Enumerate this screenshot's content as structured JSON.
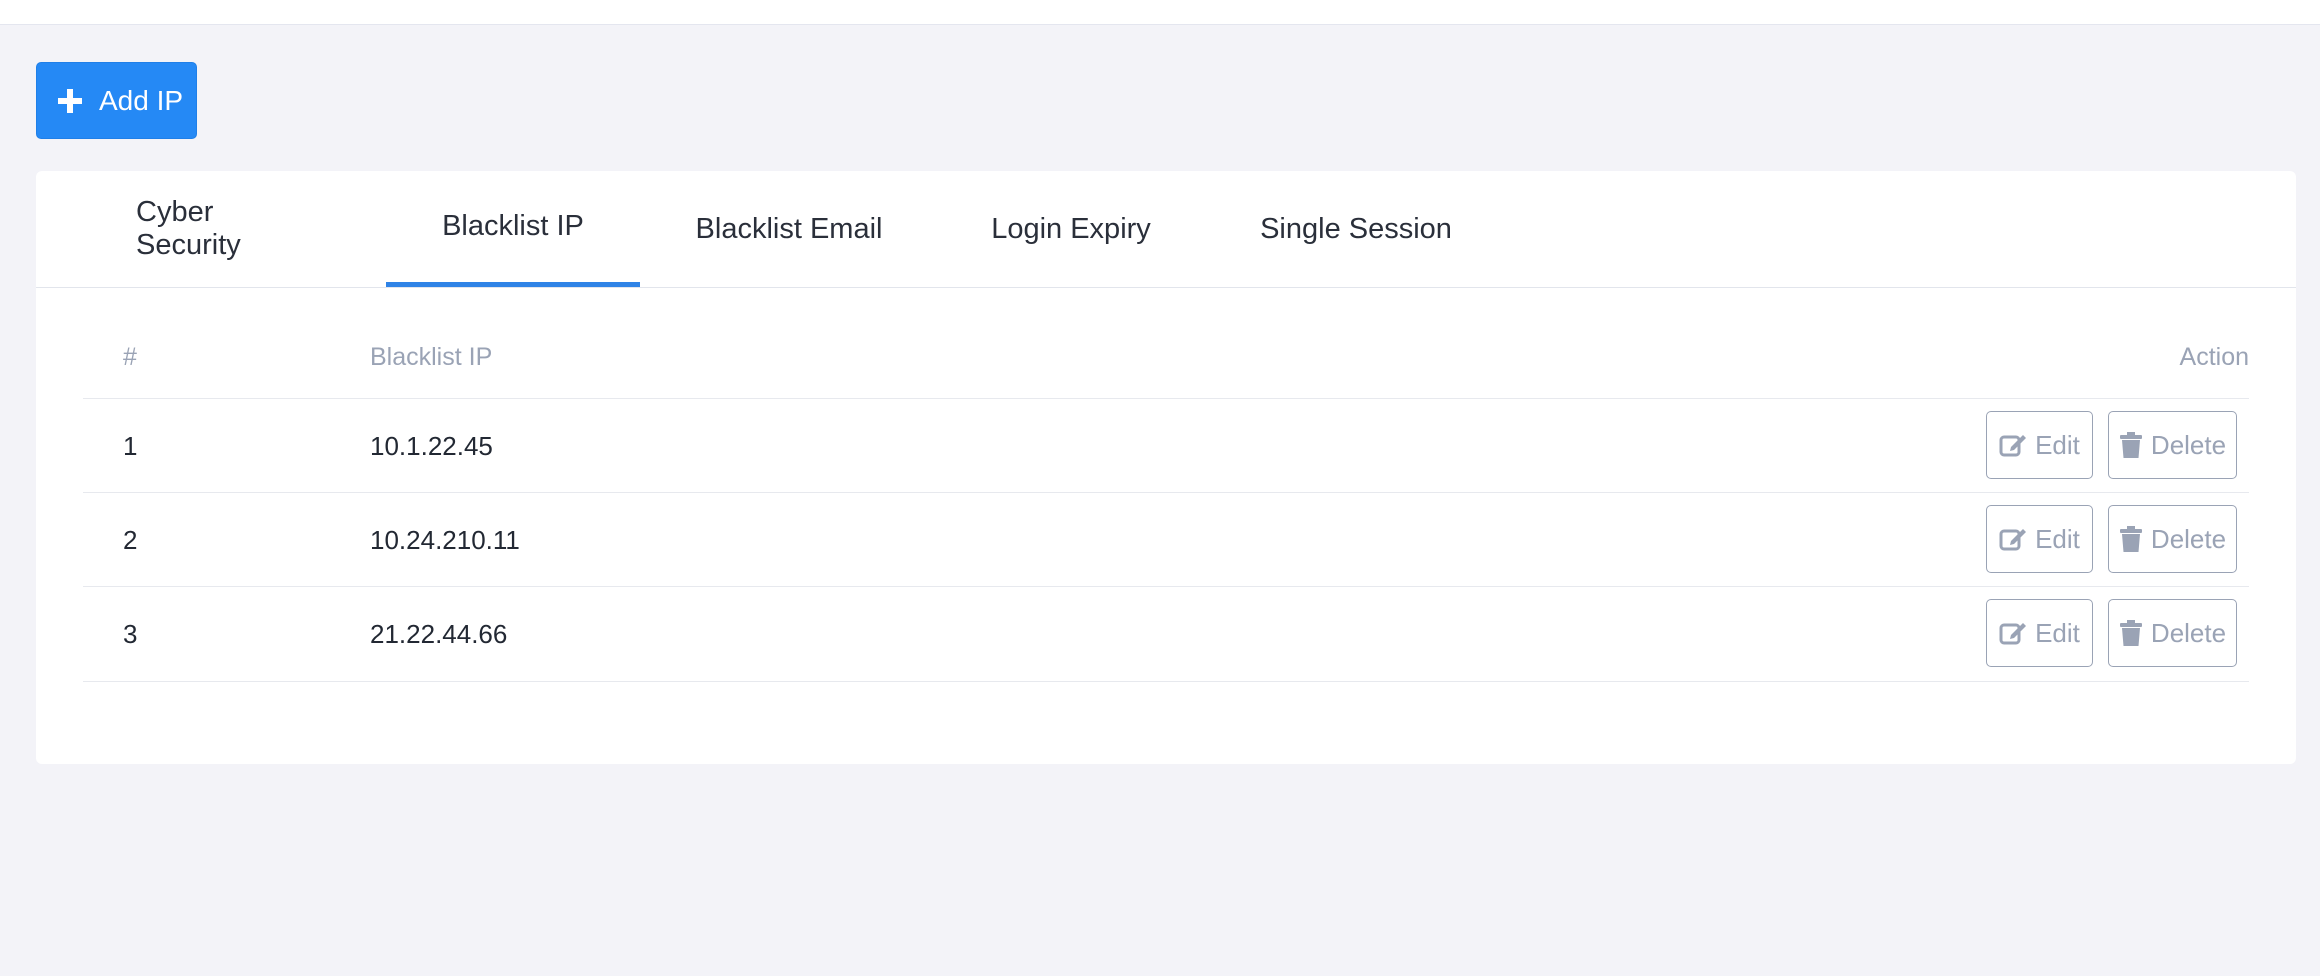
{
  "toolbar": {
    "add_label": "Add IP",
    "accent": "#2589f5"
  },
  "tabs": [
    {
      "label": "Cyber Security",
      "active": false
    },
    {
      "label": "Blacklist IP",
      "active": true
    },
    {
      "label": "Blacklist Email",
      "active": false
    },
    {
      "label": "Login Expiry",
      "active": false
    },
    {
      "label": "Single Session",
      "active": false
    }
  ],
  "table": {
    "headers": {
      "index": "#",
      "ip": "Blacklist IP",
      "action": "Action"
    },
    "rows": [
      {
        "index": "1",
        "ip": "10.1.22.45"
      },
      {
        "index": "2",
        "ip": "10.24.210.11"
      },
      {
        "index": "3",
        "ip": "21.22.44.66"
      }
    ],
    "edit_label": "Edit",
    "delete_label": "Delete"
  },
  "icons": {
    "add": "plus-icon",
    "edit": "edit-icon",
    "delete": "trash-icon"
  }
}
